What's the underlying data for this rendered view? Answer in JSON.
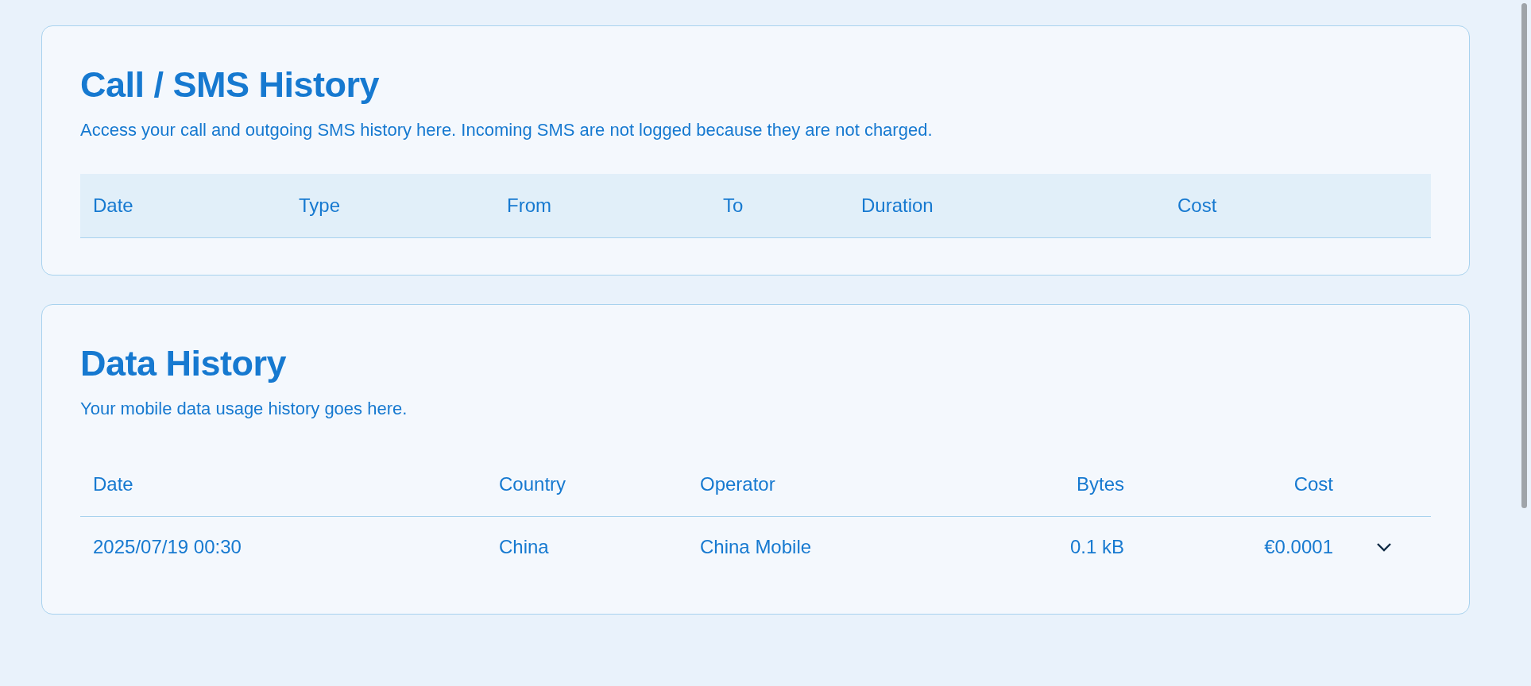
{
  "call_history": {
    "title": "Call / SMS History",
    "description": "Access your call and outgoing SMS history here. Incoming SMS are not logged because they are not charged.",
    "columns": [
      "Date",
      "Type",
      "From",
      "To",
      "Duration",
      "Cost"
    ]
  },
  "data_history": {
    "title": "Data History",
    "description": "Your mobile data usage history goes here.",
    "columns": [
      "Date",
      "Country",
      "Operator",
      "Bytes",
      "Cost"
    ],
    "rows": [
      {
        "date": "2025/07/19 00:30",
        "country": "China",
        "operator": "China Mobile",
        "bytes": "0.1 kB",
        "cost": "€0.0001",
        "expanded": false
      }
    ]
  }
}
